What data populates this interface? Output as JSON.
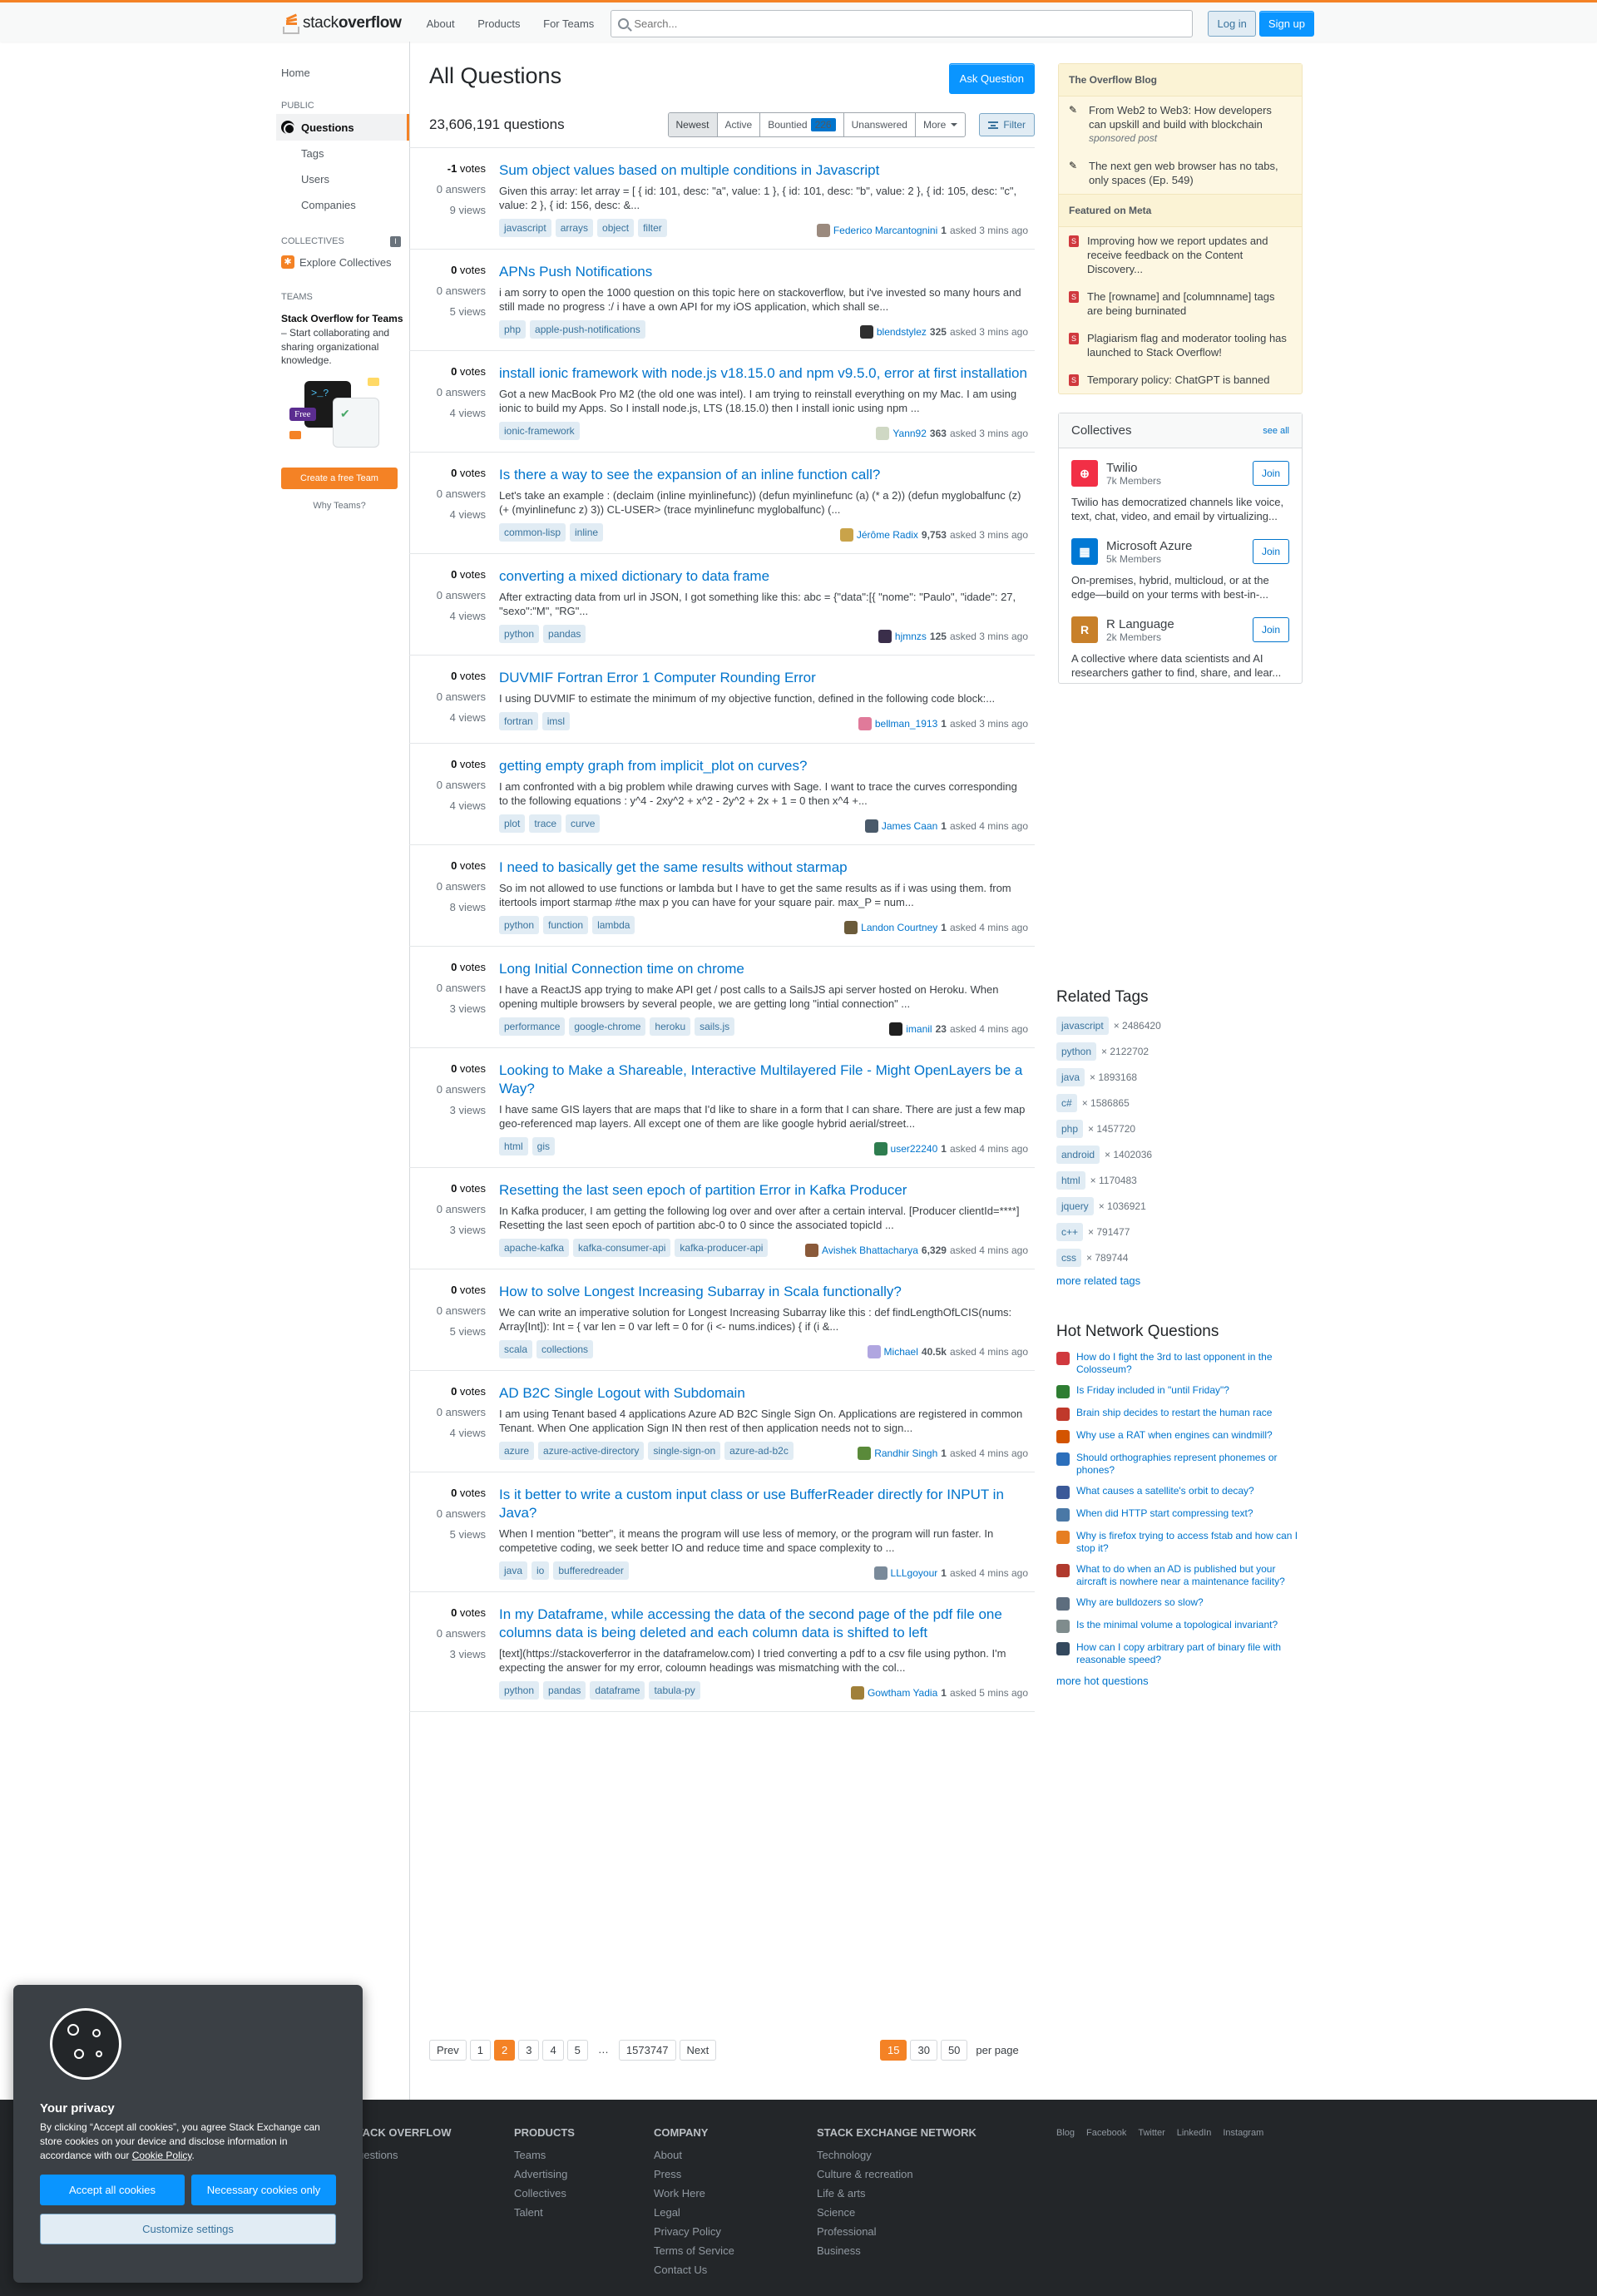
{
  "topbar": {
    "logo_plain": "stack",
    "logo_bold": "overflow",
    "nav": [
      "About",
      "Products",
      "For Teams"
    ],
    "search_placeholder": "Search...",
    "login": "Log in",
    "signup": "Sign up",
    "accent_color": "#f48225"
  },
  "sidebar": {
    "home": "Home",
    "public_label": "PUBLIC",
    "questions": "Questions",
    "tags": "Tags",
    "users": "Users",
    "companies": "Companies",
    "collectives_label": "COLLECTIVES",
    "explore_collectives": "Explore Collectives",
    "teams_label": "TEAMS",
    "teams_title": "Stack Overflow for Teams",
    "teams_desc": " – Start collaborating and sharing organizational knowledge.",
    "teams_terminal": ">_?",
    "free_badge": "Free",
    "create_team": "Create a free Team",
    "why_teams": "Why Teams?"
  },
  "main": {
    "title": "All Questions",
    "ask_button": "Ask Question",
    "question_count": "23,606,191 questions",
    "tabs": {
      "newest": "Newest",
      "active": "Active",
      "bountied": "Bountied",
      "bounty_count": "226",
      "unanswered": "Unanswered",
      "more": "More"
    },
    "filter": "Filter"
  },
  "questions": [
    {
      "votes": "-1",
      "votes_label": "votes",
      "answers": "0 answers",
      "views": "9 views",
      "title": "Sum object values based on multiple conditions in Javascript",
      "excerpt": "Given this array: let array = [ { id: 101, desc: \"a\", value: 1 }, { id: 101, desc: \"b\", value: 2 }, { id: 105, desc: \"c\", value: 2 }, { id: 156, desc: &...",
      "tags": [
        "javascript",
        "arrays",
        "object",
        "filter"
      ],
      "user": "Federico Marcantognini",
      "rep": "1",
      "time": "asked 3 mins ago",
      "avatar_color": "#9b8a7e"
    },
    {
      "votes": "0",
      "votes_label": "votes",
      "answers": "0 answers",
      "views": "5 views",
      "title": "APNs Push Notifications",
      "excerpt": "i am sorry to open the 1000 question on this topic here on stackoverflow, but i've invested so many hours and still made no progress :/ i have a own API for my iOS application, which shall se...",
      "tags": [
        "php",
        "apple-push-notifications"
      ],
      "user": "blendstylez",
      "rep": "325",
      "time": "asked 3 mins ago",
      "avatar_color": "#2f2f2f"
    },
    {
      "votes": "0",
      "votes_label": "votes",
      "answers": "0 answers",
      "views": "4 views",
      "title": "install ionic framework with node.js v18.15.0 and npm v9.5.0, error at first installation",
      "excerpt": "Got a new MacBook Pro M2 (the old one was intel). I am trying to reinstall everything on my Mac. I am using ionic to build my Apps. So I install node.js, LTS (18.15.0) then I install ionic using npm ...",
      "tags": [
        "ionic-framework"
      ],
      "user": "Yann92",
      "rep": "363",
      "time": "asked 3 mins ago",
      "avatar_color": "#cfd8c4"
    },
    {
      "votes": "0",
      "votes_label": "votes",
      "answers": "0 answers",
      "views": "4 views",
      "title": "Is there a way to see the expansion of an inline function call?",
      "excerpt": "Let's take an example : (declaim (inline myinlinefunc)) (defun myinlinefunc (a) (* a 2)) (defun myglobalfunc (z) (+ (myinlinefunc z) 3)) CL-USER> (trace myinlinefunc myglobalfunc) (...",
      "tags": [
        "common-lisp",
        "inline"
      ],
      "user": "Jérôme Radix",
      "rep": "9,753",
      "time": "asked 3 mins ago",
      "avatar_color": "#c9a34a"
    },
    {
      "votes": "0",
      "votes_label": "votes",
      "answers": "0 answers",
      "views": "4 views",
      "title": "converting a mixed dictionary to data frame",
      "excerpt": "After extracting data from url in JSON, I got something like this: abc = {\"data\":[{ \"nome\": \"Paulo\", \"idade\": 27, \"sexo\":\"M\", \"RG\"...",
      "tags": [
        "python",
        "pandas"
      ],
      "user": "hjmnzs",
      "rep": "125",
      "time": "asked 3 mins ago",
      "avatar_color": "#3a2e4a"
    },
    {
      "votes": "0",
      "votes_label": "votes",
      "answers": "0 answers",
      "views": "4 views",
      "title": "DUVMIF Fortran Error 1 Computer Rounding Error",
      "excerpt": "I using DUVMIF to estimate the minimum of my objective function, defined in the following code block:...",
      "tags": [
        "fortran",
        "imsl"
      ],
      "user": "bellman_1913",
      "rep": "1",
      "time": "asked 3 mins ago",
      "avatar_color": "#e07a9a"
    },
    {
      "votes": "0",
      "votes_label": "votes",
      "answers": "0 answers",
      "views": "4 views",
      "title": "getting empty graph from implicit_plot on curves?",
      "excerpt": "I am confronted with a big problem while drawing curves with Sage. I want to trace the curves corresponding to the following equations : y^4 - 2xy^2 + x^2 - 2y^2 + 2x + 1 = 0 then x^4 +...",
      "tags": [
        "plot",
        "trace",
        "curve"
      ],
      "user": "James Caan",
      "rep": "1",
      "time": "asked 4 mins ago",
      "avatar_color": "#4a5a6a"
    },
    {
      "votes": "0",
      "votes_label": "votes",
      "answers": "0 answers",
      "views": "8 views",
      "title": "I need to basically get the same results without starmap",
      "excerpt": "So im not allowed to use functions or lambda but I have to get the same results as if i was using them. from itertools import starmap #the max p you can have for your square pair. max_P = num...",
      "tags": [
        "python",
        "function",
        "lambda"
      ],
      "user": "Landon Courtney",
      "rep": "1",
      "time": "asked 4 mins ago",
      "avatar_color": "#6b5b3a"
    },
    {
      "votes": "0",
      "votes_label": "votes",
      "answers": "0 answers",
      "views": "3 views",
      "title": "Long Initial Connection time on chrome",
      "excerpt": "I have a ReactJS app trying to make API get / post calls to a SailsJS api server hosted on Heroku. When opening multiple browsers by several people, we are getting long \"intial connection\" ...",
      "tags": [
        "performance",
        "google-chrome",
        "heroku",
        "sails.js"
      ],
      "user": "imanil",
      "rep": "23",
      "time": "asked 4 mins ago",
      "avatar_color": "#1f1f1f"
    },
    {
      "votes": "0",
      "votes_label": "votes",
      "answers": "0 answers",
      "views": "3 views",
      "title": "Looking to Make a Shareable, Interactive Multilayered File - Might OpenLayers be a Way?",
      "excerpt": "I have same GIS layers that are maps that I'd like to share in a form that I can share. There are just a few map geo-referenced map layers. All except one of them are like google hybrid aerial/street...",
      "tags": [
        "html",
        "gis"
      ],
      "user": "user22240",
      "rep": "1",
      "time": "asked 4 mins ago",
      "avatar_color": "#2e7d4f"
    },
    {
      "votes": "0",
      "votes_label": "votes",
      "answers": "0 answers",
      "views": "3 views",
      "title": "Resetting the last seen epoch of partition Error in Kafka Producer",
      "excerpt": "In Kafka producer, I am getting the following log over and over after a certain interval. [Producer clientId=****] Resetting the last seen epoch of partition abc-0 to 0 since the associated topicId ...",
      "tags": [
        "apache-kafka",
        "kafka-consumer-api",
        "kafka-producer-api"
      ],
      "user": "Avishek Bhattacharya",
      "rep": "6,329",
      "time": "asked 4 mins ago",
      "avatar_color": "#8a5a3a"
    },
    {
      "votes": "0",
      "votes_label": "votes",
      "answers": "0 answers",
      "views": "5 views",
      "title": "How to solve Longest Increasing Subarray in Scala functionally?",
      "excerpt": "We can write an imperative solution for Longest Increasing Subarray like this : def findLengthOfLCIS(nums: Array[Int]): Int = { var len = 0 var left = 0 for (i <- nums.indices) { if (i &...",
      "tags": [
        "scala",
        "collections"
      ],
      "user": "Michael",
      "rep": "40.5k",
      "time": "asked 4 mins ago",
      "avatar_color": "#b0a6e0"
    },
    {
      "votes": "0",
      "votes_label": "votes",
      "answers": "0 answers",
      "views": "4 views",
      "title": "AD B2C Single Logout with Subdomain",
      "excerpt": "I am using Tenant based 4 applications Azure AD B2C Single Sign On. Applications are registered in common Tenant. When One application Sign IN then rest of then application needs not to sign...",
      "tags": [
        "azure",
        "azure-active-directory",
        "single-sign-on",
        "azure-ad-b2c"
      ],
      "user": "Randhir Singh",
      "rep": "1",
      "time": "asked 4 mins ago",
      "avatar_color": "#5a8a3a"
    },
    {
      "votes": "0",
      "votes_label": "votes",
      "answers": "0 answers",
      "views": "5 views",
      "title": "Is it better to write a custom input class or use BufferReader directly for INPUT in Java?",
      "excerpt": "When I mention \"better\", it means the program will use less of memory, or the program will run faster. In competetive coding, we seek better IO and reduce time and space complexity to ...",
      "tags": [
        "java",
        "io",
        "bufferedreader"
      ],
      "user": "LLLgoyour",
      "rep": "1",
      "time": "asked 4 mins ago",
      "avatar_color": "#7a8a9a"
    },
    {
      "votes": "0",
      "votes_label": "votes",
      "answers": "0 answers",
      "views": "3 views",
      "title": "In my Dataframe, while accessing the data of the second page of the pdf file one columns data is being deleted and each column data is shifted to left",
      "excerpt": "[text](https://stackoverferror in the dataframelow.com) I tried converting a pdf to a csv file using python. I'm expecting the answer for my error, coloumn headings was mismatching with the col...",
      "tags": [
        "python",
        "pandas",
        "dataframe",
        "tabula-py"
      ],
      "user": "Gowtham Yadia",
      "rep": "1",
      "time": "asked 5 mins ago",
      "avatar_color": "#a0803a"
    }
  ],
  "pagination": {
    "prev": "Prev",
    "pages": [
      "1",
      "2",
      "3",
      "4",
      "5",
      "…",
      "1573747"
    ],
    "current": "2",
    "next": "Next",
    "per_page_options": [
      "15",
      "30",
      "50"
    ],
    "per_page_current": "15",
    "per_page_label": "per page"
  },
  "blog": {
    "header": "The Overflow Blog",
    "items": [
      {
        "text": "From Web2 to Web3: How developers can upskill and build with blockchain",
        "sub": "sponsored post"
      },
      {
        "text": "The next gen web browser has no tabs, only spaces (Ep. 549)",
        "sub": ""
      }
    ],
    "meta_header": "Featured on Meta",
    "meta_items": [
      "Improving how we report updates and receive feedback on the Content Discovery...",
      "The [rowname] and [columnname] tags are being burninated",
      "Plagiarism flag and moderator tooling has launched to Stack Overflow!",
      "Temporary policy: ChatGPT is banned"
    ]
  },
  "collectives": {
    "header": "Collectives",
    "see_all": "see all",
    "join": "Join",
    "items": [
      {
        "name": "Twilio",
        "members": "7k Members",
        "desc": "Twilio has democratized channels like voice, text, chat, video, and email by virtualizing...",
        "color": "#f22f46",
        "glyph": "⊕"
      },
      {
        "name": "Microsoft Azure",
        "members": "5k Members",
        "desc": "On-premises, hybrid, multicloud, or at the edge—build on your terms with best-in-...",
        "color": "#0078d4",
        "glyph": "▦"
      },
      {
        "name": "R Language",
        "members": "2k Members",
        "desc": "A collective where data scientists and AI researchers gather to find, share, and lear...",
        "color": "#c8802a",
        "glyph": "R"
      }
    ]
  },
  "related_tags": {
    "header": "Related Tags",
    "items": [
      {
        "tag": "javascript",
        "count": "× 2486420"
      },
      {
        "tag": "python",
        "count": "× 2122702"
      },
      {
        "tag": "java",
        "count": "× 1893168"
      },
      {
        "tag": "c#",
        "count": "× 1586865"
      },
      {
        "tag": "php",
        "count": "× 1457720"
      },
      {
        "tag": "android",
        "count": "× 1402036"
      },
      {
        "tag": "html",
        "count": "× 1170483"
      },
      {
        "tag": "jquery",
        "count": "× 1036921"
      },
      {
        "tag": "c++",
        "count": "× 791477"
      },
      {
        "tag": "css",
        "count": "× 789744"
      }
    ],
    "more": "more related tags"
  },
  "hot_network": {
    "header": "Hot Network Questions",
    "items": [
      {
        "text": "How do I fight the 3rd to last opponent in the Colosseum?",
        "color": "#d0393e"
      },
      {
        "text": "Is Friday included in \"until Friday\"?",
        "color": "#2e7d32"
      },
      {
        "text": "Brain ship decides to restart the human race",
        "color": "#c0392b"
      },
      {
        "text": "Why use a RAT when engines can windmill?",
        "color": "#d35400"
      },
      {
        "text": "Should orthographies represent phonemes or phones?",
        "color": "#2c6fbb"
      },
      {
        "text": "What causes a satellite's orbit to decay?",
        "color": "#3b5998"
      },
      {
        "text": "When did HTTP start compressing text?",
        "color": "#4a78a6"
      },
      {
        "text": "Why is firefox trying to access fstab and how can I stop it?",
        "color": "#e67e22"
      },
      {
        "text": "What to do when an AD is published but your aircraft is nowhere near a maintenance facility?",
        "color": "#b03a2e"
      },
      {
        "text": "Why are bulldozers so slow?",
        "color": "#5d6d7e"
      },
      {
        "text": "Is the minimal volume a topological invariant?",
        "color": "#7f8c8d"
      },
      {
        "text": "How can I copy arbitrary part of binary file with reasonable speed?",
        "color": "#34495e"
      }
    ],
    "more": "more hot questions"
  },
  "footer": {
    "so_header": "STACK OVERFLOW",
    "so_links": [
      "Questions"
    ],
    "products_header": "PRODUCTS",
    "products_links": [
      "Teams",
      "Advertising",
      "Collectives",
      "Talent"
    ],
    "company_header": "COMPANY",
    "company_links": [
      "About",
      "Press",
      "Work Here",
      "Legal",
      "Privacy Policy",
      "Terms of Service",
      "Contact Us"
    ],
    "network_header": "STACK EXCHANGE NETWORK",
    "network_links": [
      "Technology",
      "Culture & recreation",
      "Life & arts",
      "Science",
      "Professional",
      "Business"
    ],
    "social": [
      "Blog",
      "Facebook",
      "Twitter",
      "LinkedIn",
      "Instagram"
    ]
  },
  "cookie": {
    "title": "Your privacy",
    "text": "By clicking “Accept all cookies”, you agree Stack Exchange can store cookies on your device and disclose information in accordance with our ",
    "link": "Cookie Policy",
    "text_end": ".",
    "accept": "Accept all cookies",
    "necessary": "Necessary cookies only",
    "customize": "Customize settings"
  }
}
